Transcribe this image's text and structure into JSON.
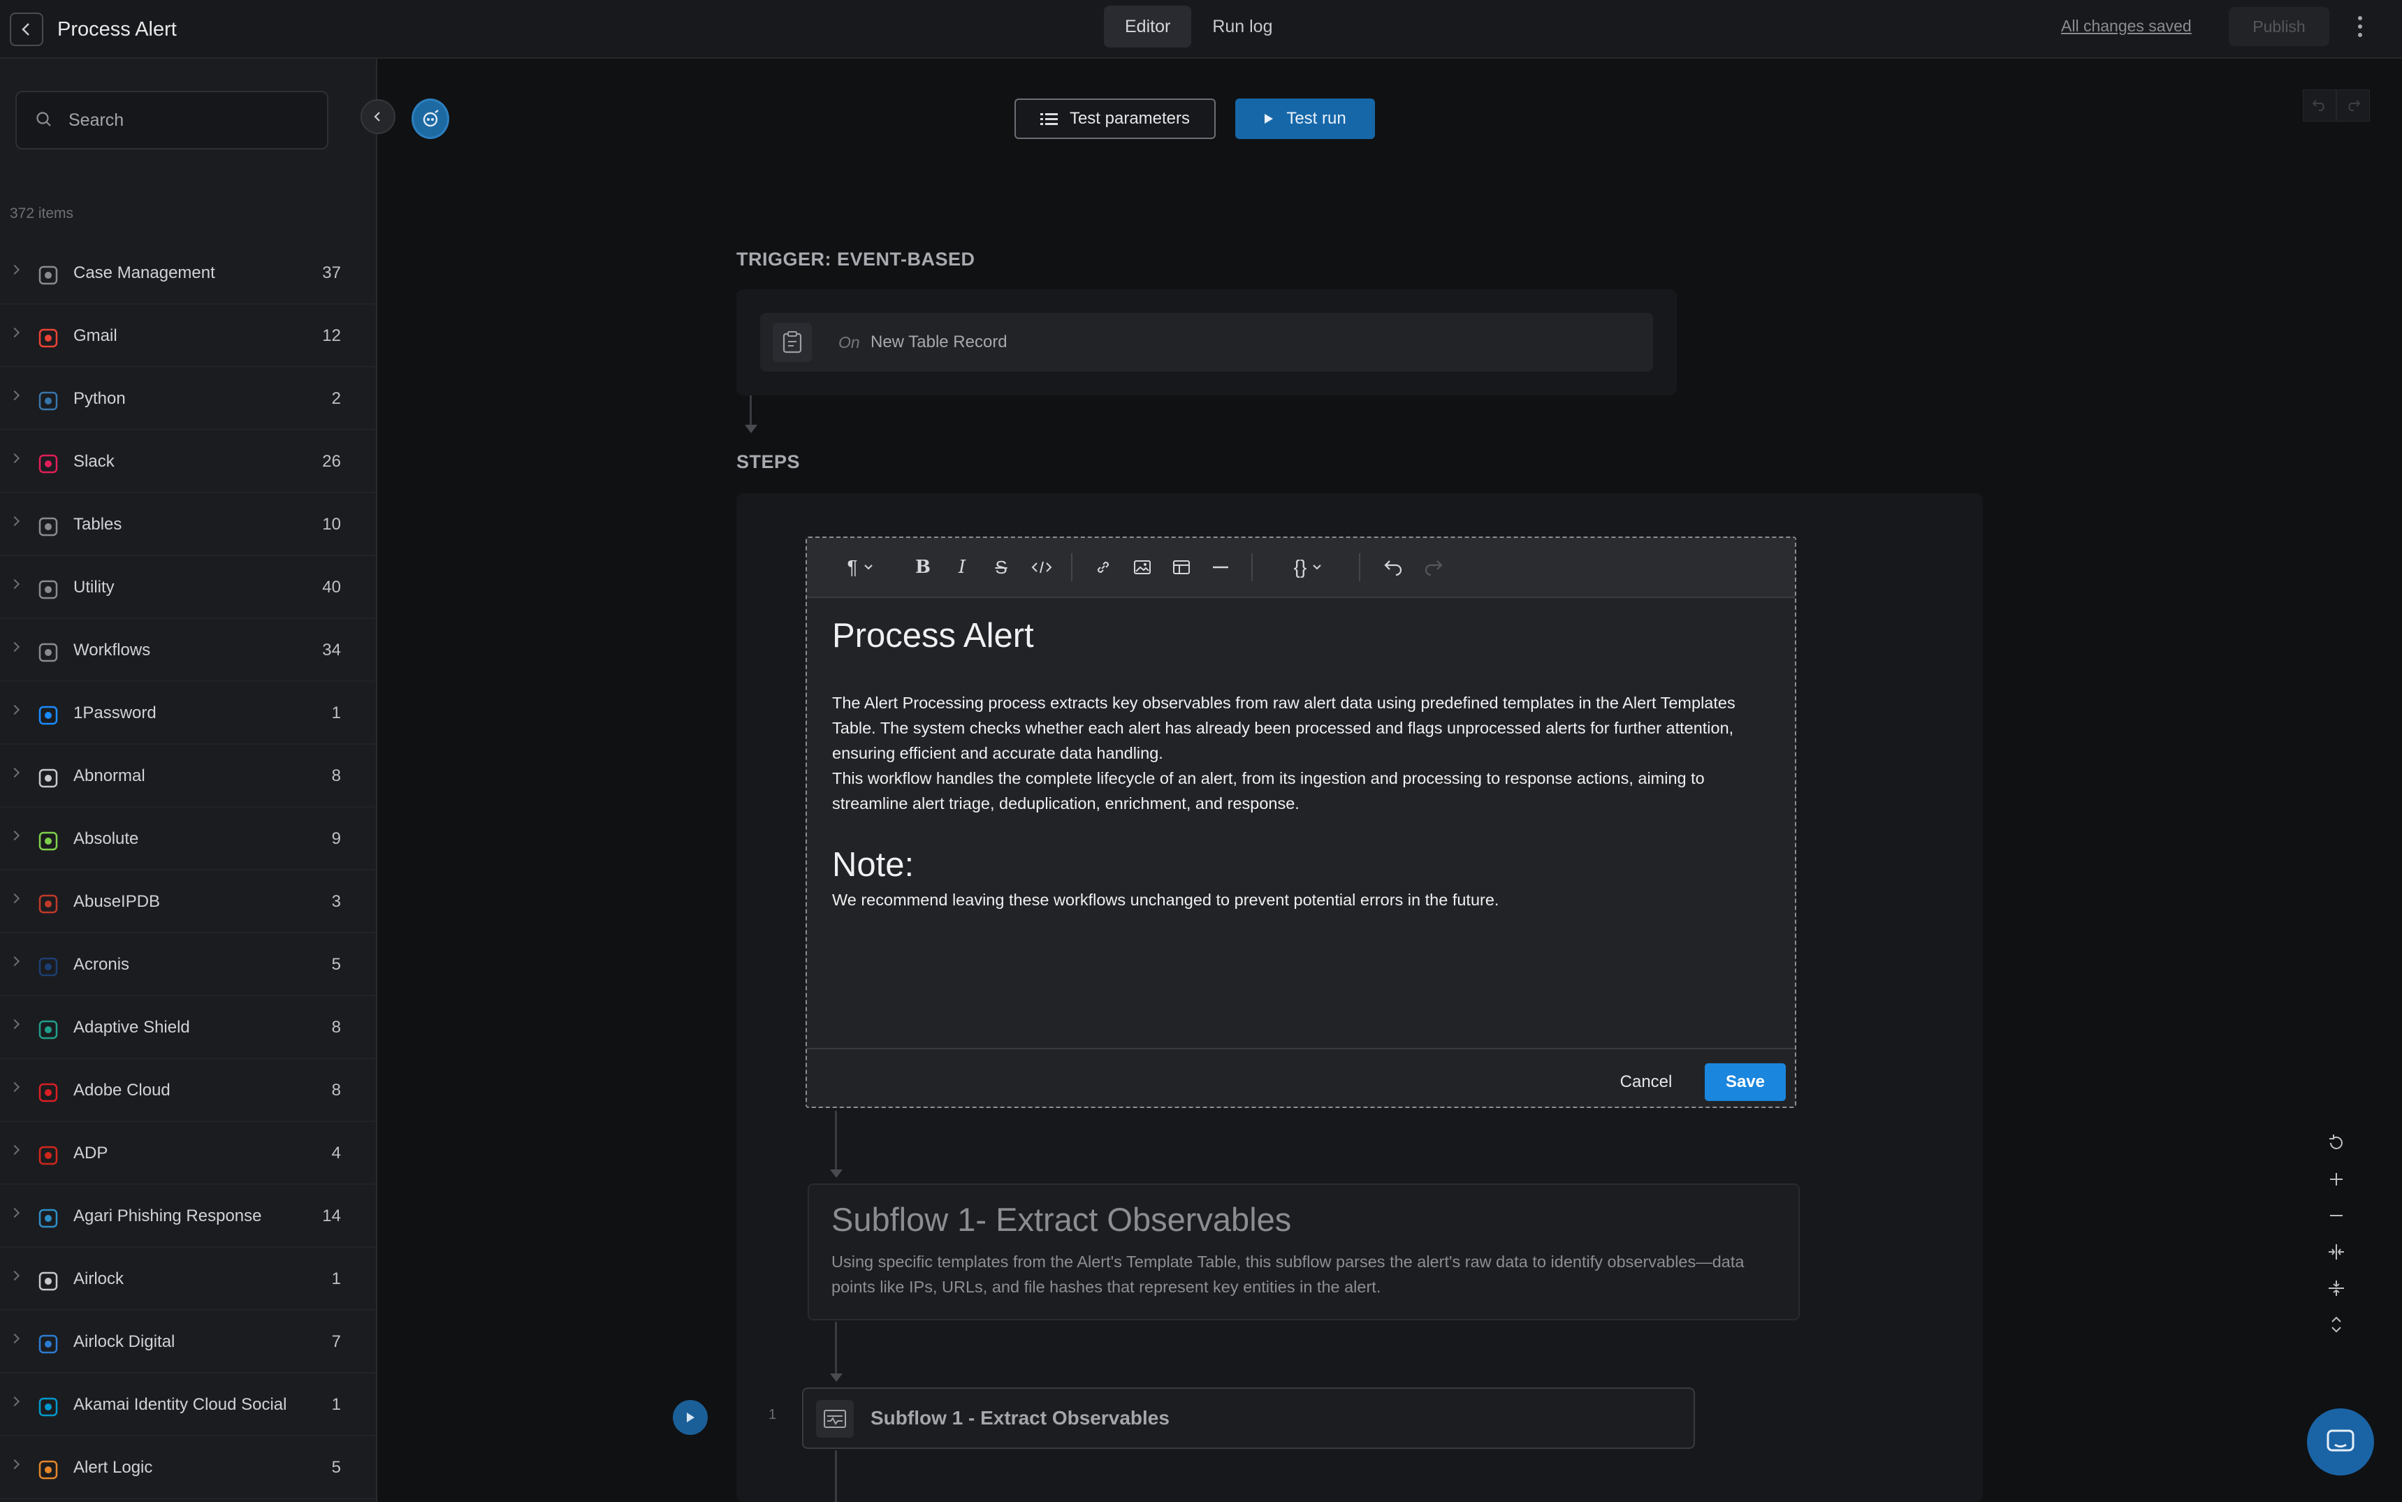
{
  "header": {
    "title": "Process Alert",
    "tabs": [
      {
        "label": "Editor"
      },
      {
        "label": "Run log"
      }
    ],
    "saved_status": "All changes saved",
    "publish_label": "Publish"
  },
  "sidebar": {
    "search_placeholder": "Search",
    "items_count": "372 items",
    "items": [
      {
        "label": "Case Management",
        "count": "37",
        "icon": "clipboard-icon",
        "color": "#8a8b90"
      },
      {
        "label": "Gmail",
        "count": "12",
        "icon": "gmail-icon",
        "color": "#ea4335"
      },
      {
        "label": "Python",
        "count": "2",
        "icon": "python-icon",
        "color": "#3776ab"
      },
      {
        "label": "Slack",
        "count": "26",
        "icon": "slack-icon",
        "color": "#e01e5a"
      },
      {
        "label": "Tables",
        "count": "10",
        "icon": "table-icon",
        "color": "#8a8b90"
      },
      {
        "label": "Utility",
        "count": "40",
        "icon": "wrench-icon",
        "color": "#8a8b90"
      },
      {
        "label": "Workflows",
        "count": "34",
        "icon": "workflow-icon",
        "color": "#8a8b90"
      },
      {
        "label": "1Password",
        "count": "1",
        "icon": "onepassword-icon",
        "color": "#1a8cff"
      },
      {
        "label": "Abnormal",
        "count": "8",
        "icon": "abnormal-icon",
        "color": "#c8c9cc"
      },
      {
        "label": "Absolute",
        "count": "9",
        "icon": "absolute-icon",
        "color": "#7fd14b"
      },
      {
        "label": "AbuseIPDB",
        "count": "3",
        "icon": "abuseipdb-icon",
        "color": "#c0392b"
      },
      {
        "label": "Acronis",
        "count": "5",
        "icon": "acronis-icon",
        "color": "#1c3f73"
      },
      {
        "label": "Adaptive Shield",
        "count": "8",
        "icon": "shield-icon",
        "color": "#1fa08a"
      },
      {
        "label": "Adobe Cloud",
        "count": "8",
        "icon": "adobe-icon",
        "color": "#da1f26"
      },
      {
        "label": "ADP",
        "count": "4",
        "icon": "adp-icon",
        "color": "#d0271d"
      },
      {
        "label": "Agari Phishing Response",
        "count": "14",
        "icon": "agari-icon",
        "color": "#2e8fc8"
      },
      {
        "label": "Airlock",
        "count": "1",
        "icon": "airlock-icon",
        "color": "#c8c9cc"
      },
      {
        "label": "Airlock Digital",
        "count": "7",
        "icon": "airlock-digital-icon",
        "color": "#2d7bd1"
      },
      {
        "label": "Akamai Identity Cloud Social",
        "count": "1",
        "icon": "akamai-icon",
        "color": "#0099cc"
      },
      {
        "label": "Alert Logic",
        "count": "5",
        "icon": "alertlogic-icon",
        "color": "#e5862b"
      }
    ]
  },
  "toolbar": {
    "test_parameters": "Test parameters",
    "test_run": "Test run"
  },
  "trigger": {
    "section_label": "TRIGGER: EVENT-BASED",
    "on_label": "On",
    "record_label": "New Table Record"
  },
  "steps": {
    "section_label": "STEPS"
  },
  "editor": {
    "heading": "Process Alert",
    "paragraph1": "The Alert Processing process extracts key observables from raw alert data using predefined templates in the Alert Templates Table. The system checks whether each alert has already been processed and flags unprocessed alerts for further attention, ensuring efficient and accurate data handling.",
    "paragraph2": "This workflow handles the complete lifecycle of an alert, from its ingestion and processing to response actions, aiming to streamline alert triage, deduplication, enrichment, and response.",
    "note_heading": "Note:",
    "note_text": "We recommend leaving these workflows unchanged to prevent potential errors in the future.",
    "cancel_label": "Cancel",
    "save_label": "Save"
  },
  "subflow_note": {
    "title": "Subflow 1- Extract Observables",
    "description": "Using specific templates from the Alert's Template Table, this subflow parses the alert's raw data to identify observables—data points like IPs, URLs, and file hashes that represent key entities in the alert."
  },
  "step1": {
    "number": "1",
    "title": "Subflow 1 - Extract Observables"
  },
  "colors": {
    "accent": "#1a86de",
    "test_run": "#1667a8"
  }
}
